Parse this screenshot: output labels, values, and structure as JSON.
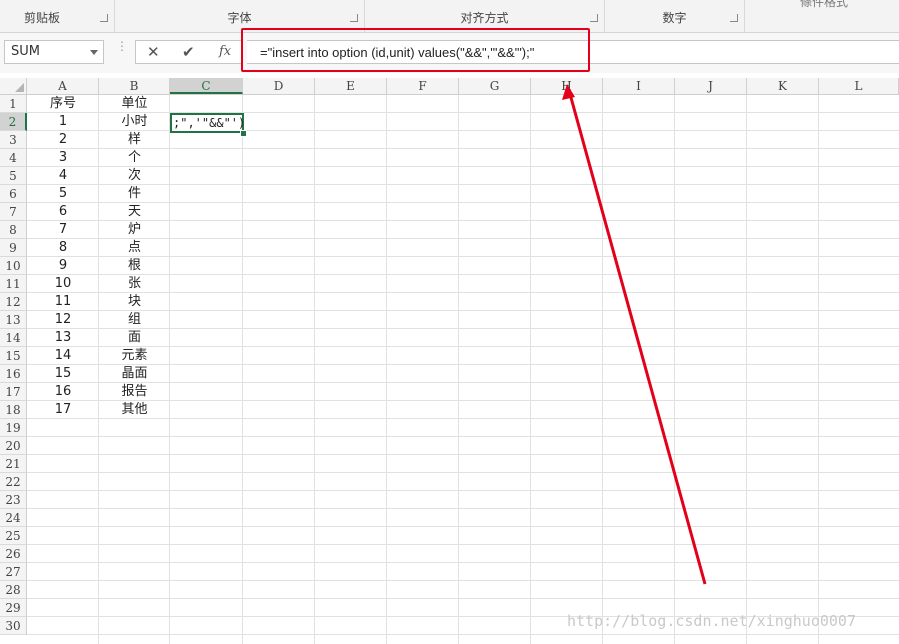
{
  "ribbon": {
    "groups": [
      {
        "label": "剪贴板"
      },
      {
        "label": "字体"
      },
      {
        "label": "对齐方式"
      },
      {
        "label": "数字"
      }
    ],
    "cut_label": "條件格式"
  },
  "formula_bar": {
    "name_box": "SUM",
    "fx_label": "fx",
    "formula": "=\"insert into option (id,unit) values(\"&&\",'\"&&\"');\""
  },
  "sheet": {
    "columns": [
      "A",
      "B",
      "C",
      "D",
      "E",
      "F",
      "G",
      "H",
      "I",
      "J",
      "K",
      "L"
    ],
    "selected_column": "C",
    "rows": [
      "1",
      "2",
      "3",
      "4",
      "5",
      "6",
      "7",
      "8",
      "9",
      "10",
      "11",
      "12",
      "13",
      "14",
      "15",
      "16",
      "17",
      "18",
      "19",
      "20",
      "21",
      "22",
      "23",
      "24",
      "25",
      "26",
      "27",
      "28",
      "29",
      "30"
    ],
    "selected_row": "2",
    "header_row": {
      "a": "序号",
      "b": "单位"
    },
    "data": [
      {
        "a": "1",
        "b": "小时"
      },
      {
        "a": "2",
        "b": "样"
      },
      {
        "a": "3",
        "b": "个"
      },
      {
        "a": "4",
        "b": "次"
      },
      {
        "a": "5",
        "b": "件"
      },
      {
        "a": "6",
        "b": "天"
      },
      {
        "a": "7",
        "b": "炉"
      },
      {
        "a": "8",
        "b": "点"
      },
      {
        "a": "9",
        "b": "根"
      },
      {
        "a": "10",
        "b": "张"
      },
      {
        "a": "11",
        "b": "块"
      },
      {
        "a": "12",
        "b": "组"
      },
      {
        "a": "13",
        "b": "面"
      },
      {
        "a": "14",
        "b": "元素"
      },
      {
        "a": "15",
        "b": "晶面"
      },
      {
        "a": "16",
        "b": "报告"
      },
      {
        "a": "17",
        "b": "其他"
      }
    ],
    "active_cell_text": ";\",'\"&&\"')"
  },
  "watermark": "http://blog.csdn.net/xinghuo0007",
  "colors": {
    "accent": "#217346",
    "annotation_red": "#e3001b"
  }
}
